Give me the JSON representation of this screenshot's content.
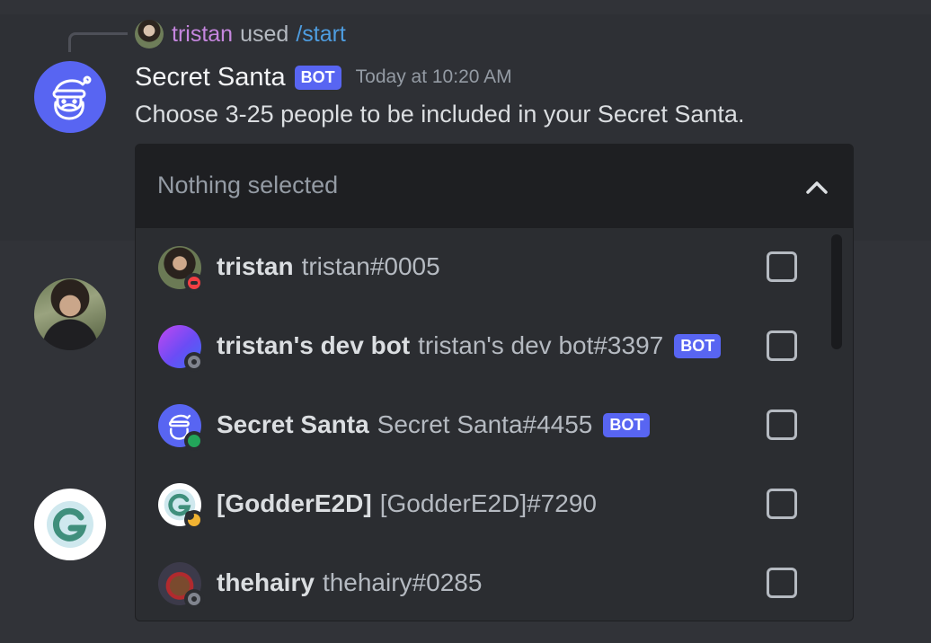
{
  "reply": {
    "user": "tristan",
    "text": "used",
    "command": "/start"
  },
  "message": {
    "author": "Secret Santa",
    "bot_tag": "BOT",
    "timestamp": "Today at 10:20 AM",
    "content": "Choose 3-25 people to be included in your Secret Santa."
  },
  "select_menu": {
    "placeholder": "Nothing selected",
    "expanded": true,
    "options": [
      {
        "name": "tristan",
        "description": "tristan#0005",
        "bot": false,
        "status": "dnd",
        "checked": false
      },
      {
        "name": "tristan's dev bot",
        "description": "tristan's dev bot#3397",
        "bot": true,
        "bot_tag": "BOT",
        "status": "offline",
        "checked": false
      },
      {
        "name": "Secret Santa",
        "description": "Secret Santa#4455",
        "bot": true,
        "bot_tag": "BOT",
        "status": "online",
        "checked": false
      },
      {
        "name": "[GodderE2D]",
        "description": "[GodderE2D]#7290",
        "bot": false,
        "status": "idle",
        "checked": false
      },
      {
        "name": "thehairy",
        "description": "thehairy#0285",
        "bot": false,
        "status": "offline",
        "checked": false
      }
    ]
  },
  "colors": {
    "background": "#313338",
    "blurple": "#5865f2",
    "reply_user": "#c586de",
    "command_link": "#4e9de0",
    "status_online": "#23a55a",
    "status_dnd": "#f23f43",
    "status_idle": "#f0b232",
    "status_offline": "#80848e"
  },
  "icons": {
    "bot_avatar": "santa-icon",
    "chevron": "chevron-up-icon"
  }
}
